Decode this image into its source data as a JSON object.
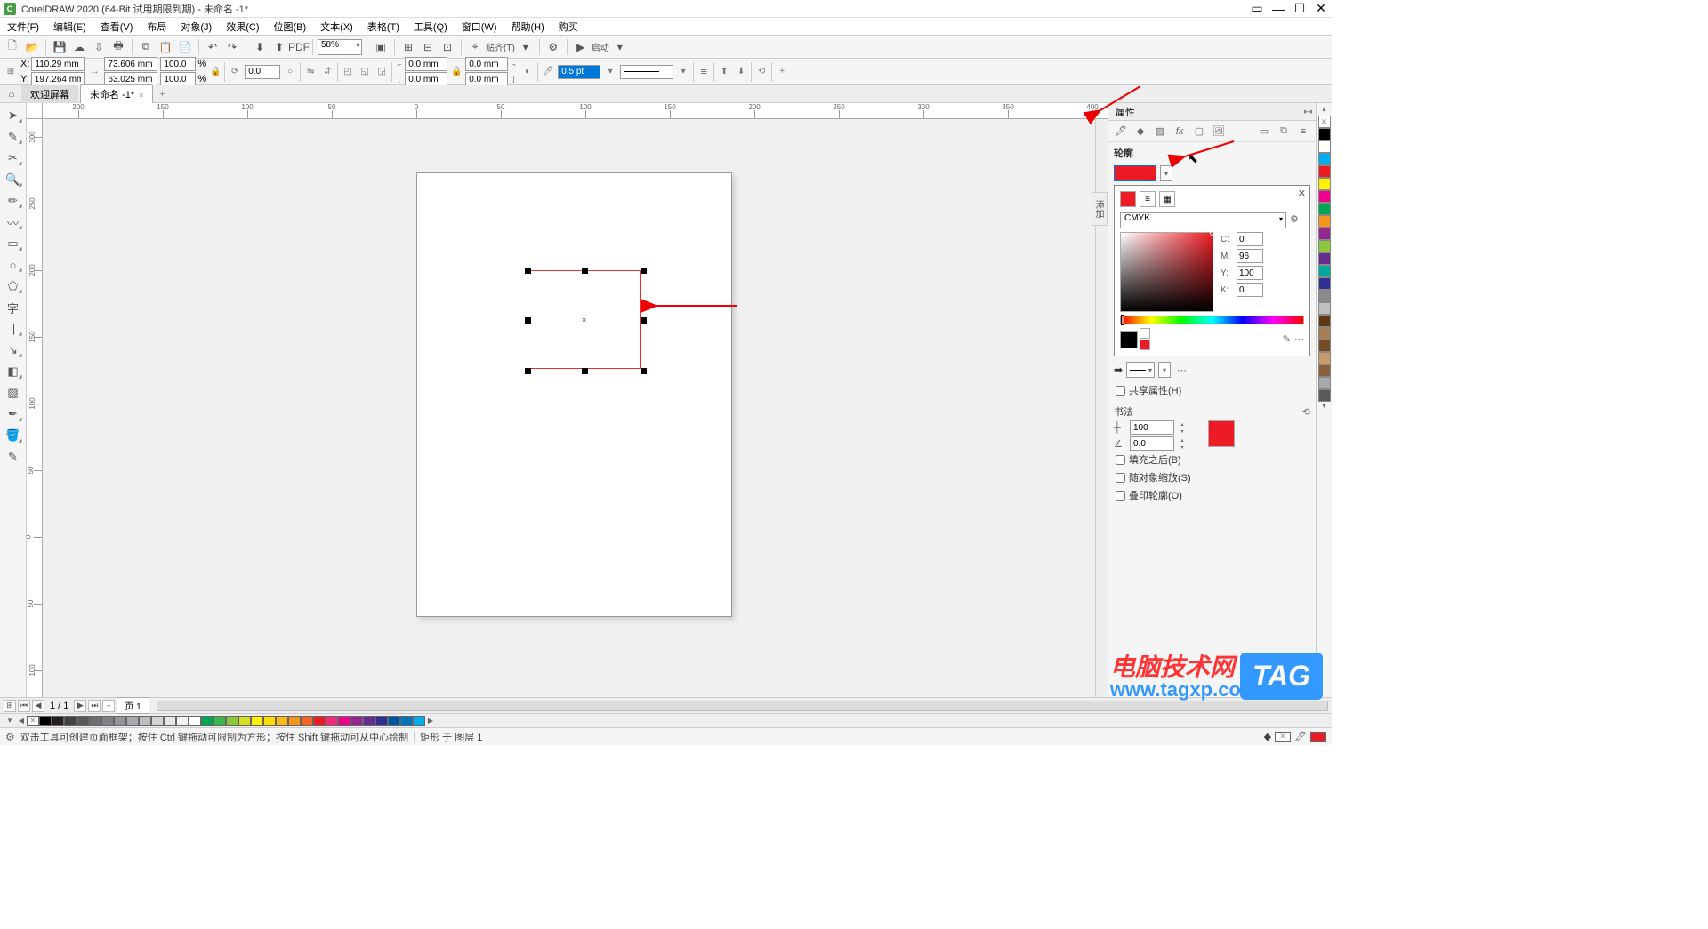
{
  "title": "CorelDRAW 2020 (64-Bit 试用期限到期) - 未命名 -1*",
  "menu": [
    "文件(F)",
    "编辑(E)",
    "查看(V)",
    "布局",
    "对象(J)",
    "效果(C)",
    "位图(B)",
    "文本(X)",
    "表格(T)",
    "工具(Q)",
    "窗口(W)",
    "帮助(H)",
    "购买"
  ],
  "toolbar1": {
    "zoom": "58%",
    "align_label": "贴齐(T)",
    "launch_label": "启动"
  },
  "propbar": {
    "x_label": "X:",
    "y_label": "Y:",
    "x": "110.29 mm",
    "y": "197.264 mm",
    "w": "73.606 mm",
    "h": "63.025 mm",
    "sx": "100.0",
    "sy": "100.0",
    "pct": "%",
    "rot": "0.0",
    "corner1": "0.0 mm",
    "corner2": "0.0 mm",
    "corner3": "0.0 mm",
    "corner4": "0.0 mm",
    "outline_w": "0.5 pt"
  },
  "tabs": {
    "welcome": "欢迎屏幕",
    "doc": "未命名 -1*"
  },
  "ruler_h_labels": [
    "200",
    "150",
    "100",
    "50",
    "0",
    "50",
    "100",
    "150",
    "200",
    "250",
    "300",
    "350",
    "400"
  ],
  "ruler_v_labels": [
    "300",
    "250",
    "200",
    "150",
    "100",
    "50",
    "0",
    "50",
    "100"
  ],
  "panel": {
    "title": "属性",
    "section_outline": "轮廓",
    "color_model": "CMYK",
    "c_label": "C:",
    "m_label": "M:",
    "y_label": "Y:",
    "k_label": "K:",
    "c": "0",
    "m": "96",
    "y": "100",
    "k": "0",
    "share_attrs": "共享属性(H)",
    "calligraphy": "书法",
    "calli_val1": "100",
    "calli_val2": "0.0",
    "behind_fill": "填充之后(B)",
    "scale_with": "随对象缩放(S)",
    "overprint": "叠印轮廓(O)"
  },
  "side_tab": "添加",
  "page_nav": {
    "page_count": "1 / 1",
    "page_label": "页 1"
  },
  "status": {
    "hint": "双击工具可创建页面框架；按住 Ctrl 键拖动可限制为方形；按住 Shift 键拖动可从中心绘制",
    "object": "矩形 于 图层 1"
  },
  "right_palette": [
    "#000000",
    "#ffffff",
    "#00aeef",
    "#ed1c24",
    "#fff200",
    "#ec008c",
    "#00a651",
    "#f7941d",
    "#92278f",
    "#8dc63f",
    "#662d91",
    "#00a99d",
    "#2e3192",
    "#898989",
    "#c0c0c0",
    "#603913",
    "#a67c52",
    "#754c24",
    "#c69c6d",
    "#8b5e3c",
    "#a6a8ab",
    "#58595b"
  ],
  "bottom_palette": [
    "#000000",
    "#231f20",
    "#414042",
    "#58595b",
    "#6d6e71",
    "#808285",
    "#939598",
    "#a7a9ac",
    "#bcbec0",
    "#d1d3d4",
    "#e6e7e8",
    "#f1f2f2",
    "#ffffff",
    "#00a651",
    "#39b54a",
    "#8dc63f",
    "#d7df23",
    "#fff200",
    "#ffde00",
    "#fdb913",
    "#f7941d",
    "#f26522",
    "#ed1c24",
    "#ee2a7b",
    "#ec008c",
    "#92278f",
    "#662d91",
    "#2e3192",
    "#0054a6",
    "#0072bc",
    "#00aeef"
  ],
  "watermark": {
    "cn": "电脑技术网",
    "url": "www.tagxp.com",
    "tag": "TAG"
  }
}
